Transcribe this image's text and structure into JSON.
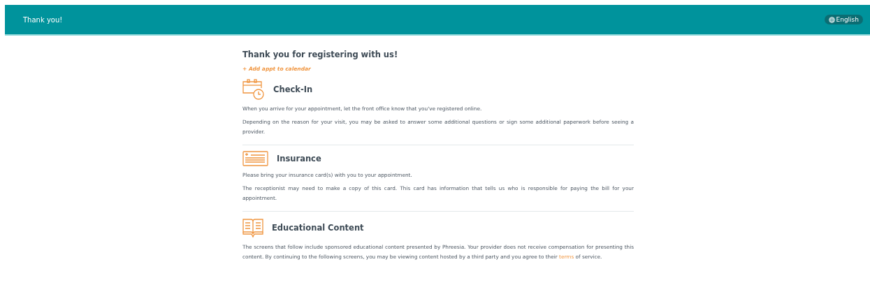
{
  "header": {
    "title": "Thank you!",
    "language": "English"
  },
  "heading": "Thank you for registering with us!",
  "calendar_link": "+ Add appt to calendar",
  "sections": [
    {
      "kind": "calendar",
      "title": "Check-In",
      "paragraphs": [
        {
          "text": "When you arrive for your appointment, let the front office know that you've registered online."
        },
        {
          "text": "Depending on the reason for your visit, you may be asked to answer some additional questions or sign some additional paperwork before seeing a provider."
        }
      ]
    },
    {
      "kind": "card",
      "title": "Insurance",
      "paragraphs": [
        {
          "text": "Please bring your insurance card(s) with you to your appointment."
        },
        {
          "text": "The receptionist may need to make a copy of this card. This card has information that tells us who is responsible for paying the bill for your appointment."
        }
      ]
    },
    {
      "kind": "book",
      "title": "Educational Content",
      "paragraphs": [
        {
          "text": "The screens that follow include sponsored educational content presented by Phreesia. Your provider does not receive compensation for presenting this content. By continuing to the following screens, you may be viewing content hosted by a third party and you agree to their",
          "link": "terms",
          "after": "of service."
        }
      ]
    }
  ]
}
